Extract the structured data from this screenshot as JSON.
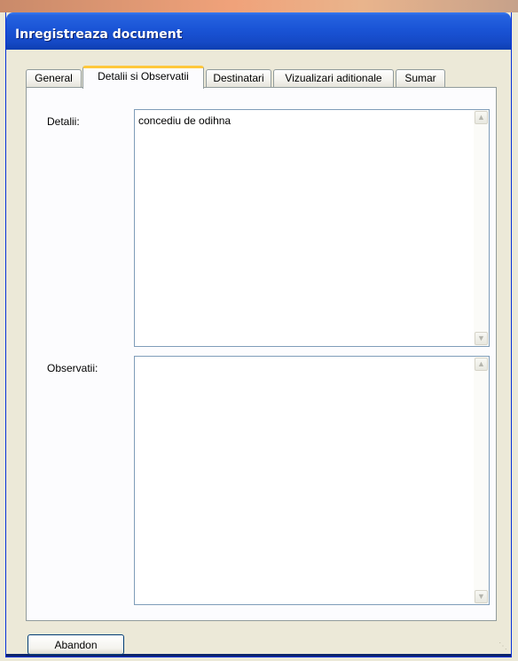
{
  "window": {
    "title": "Inregistreaza document"
  },
  "tabs": [
    {
      "label": "General",
      "active": false
    },
    {
      "label": "Detalii si Observatii",
      "active": true
    },
    {
      "label": "Destinatari",
      "active": false
    },
    {
      "label": "Vizualizari aditionale",
      "active": false
    },
    {
      "label": "Sumar",
      "active": false
    }
  ],
  "details": {
    "label": "Detalii:",
    "value": "concediu de odihna"
  },
  "observations": {
    "label": "Observatii:",
    "value": ""
  },
  "footer": {
    "abandon_label": "Abandon"
  },
  "icons": {
    "scroll_up": "scroll-up-arrow-icon",
    "scroll_down": "scroll-down-arrow-icon",
    "resize_grip": "resize-grip-icon"
  },
  "colors": {
    "titlebar": "#1a54d6",
    "active_tab_highlight": "#ffc83c",
    "dialog_background": "#ece9d8"
  }
}
